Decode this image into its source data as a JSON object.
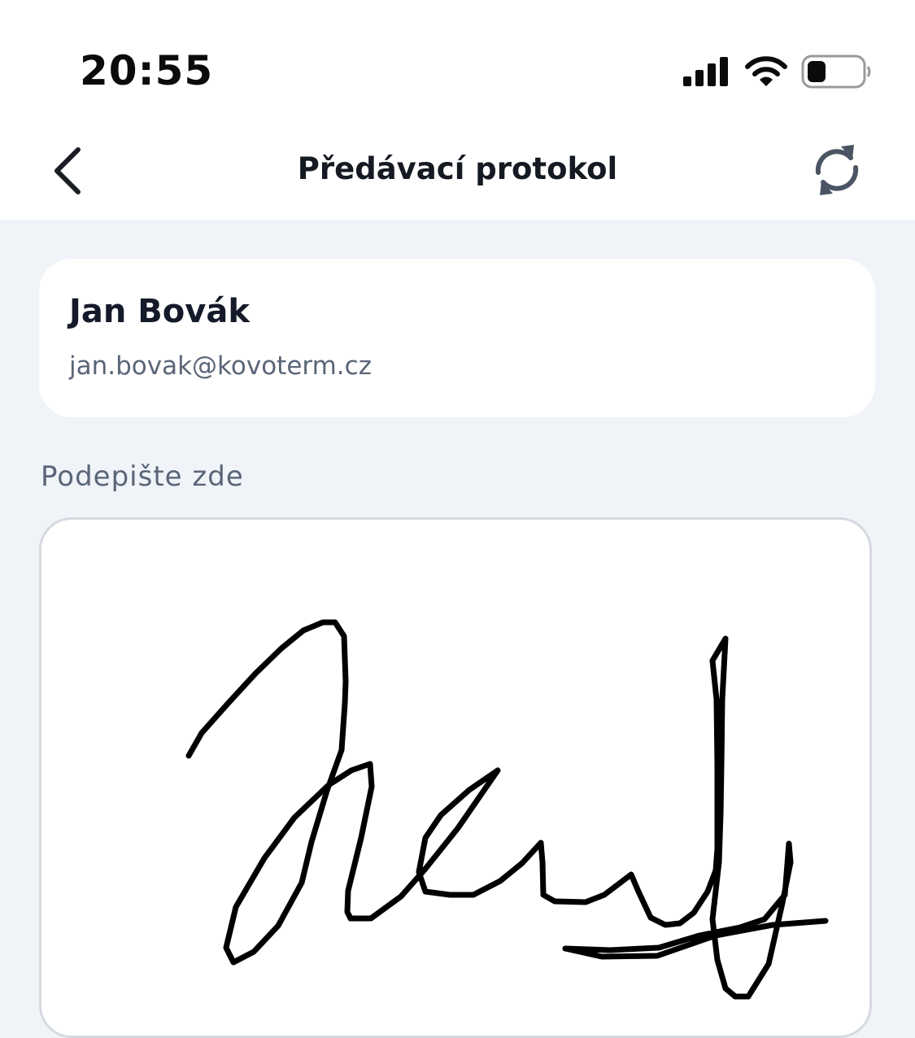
{
  "status_bar": {
    "time": "20:55",
    "icons": [
      "cellular-signal-icon",
      "wifi-icon",
      "battery-icon"
    ]
  },
  "nav": {
    "back_icon": "chevron-left-icon",
    "title": "Předávací protokol",
    "refresh_icon": "refresh-icon"
  },
  "user": {
    "name": "Jan Bovák",
    "email": "jan.bovak@kovoterm.cz"
  },
  "signature": {
    "label": "Podepište zde",
    "stroke_color": "#000000"
  },
  "colors": {
    "background": "#F0F3F7",
    "card": "#FFFFFF",
    "title_text": "#151A22",
    "secondary_text": "#5A6678",
    "pad_border": "#D6DAE0"
  }
}
